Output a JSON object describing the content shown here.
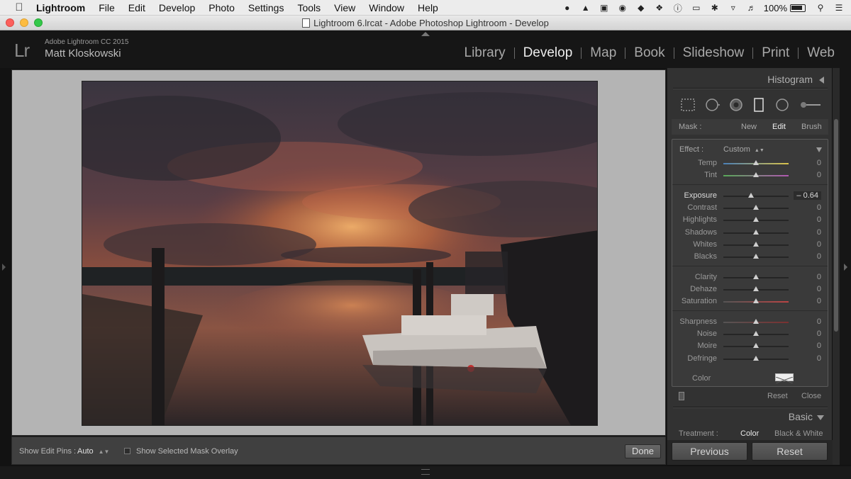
{
  "menubar": {
    "app": "Lightroom",
    "items": [
      "File",
      "Edit",
      "Develop",
      "Photo",
      "Settings",
      "Tools",
      "View",
      "Window",
      "Help"
    ],
    "battery": "100%"
  },
  "window": {
    "title": "Lightroom 6.lrcat - Adobe Photoshop Lightroom - Develop"
  },
  "identity": {
    "logo": "Lr",
    "brand": "Adobe Lightroom CC 2015",
    "user": "Matt Kloskowski"
  },
  "modules": [
    {
      "label": "Library",
      "active": false
    },
    {
      "label": "Develop",
      "active": true
    },
    {
      "label": "Map",
      "active": false
    },
    {
      "label": "Book",
      "active": false
    },
    {
      "label": "Slideshow",
      "active": false
    },
    {
      "label": "Print",
      "active": false
    },
    {
      "label": "Web",
      "active": false
    }
  ],
  "toolbar": {
    "edit_pins_label": "Show Edit Pins :",
    "edit_pins_value": "Auto",
    "overlay_label": "Show Selected Mask Overlay",
    "done_label": "Done"
  },
  "panel": {
    "histogram_title": "Histogram",
    "mask": {
      "label": "Mask :",
      "new": "New",
      "edit": "Edit",
      "brush": "Brush"
    },
    "effect": {
      "label": "Effect :",
      "value": "Custom"
    },
    "groups": [
      [
        {
          "name": "Temp",
          "value": "0",
          "position": 0.5
        },
        {
          "name": "Tint",
          "value": "0",
          "position": 0.5
        }
      ],
      [
        {
          "name": "Exposure",
          "value": "– 0.64",
          "position": 0.42
        },
        {
          "name": "Contrast",
          "value": "0",
          "position": 0.5
        },
        {
          "name": "Highlights",
          "value": "0",
          "position": 0.5
        },
        {
          "name": "Shadows",
          "value": "0",
          "position": 0.5
        },
        {
          "name": "Whites",
          "value": "0",
          "position": 0.5
        },
        {
          "name": "Blacks",
          "value": "0",
          "position": 0.5
        }
      ],
      [
        {
          "name": "Clarity",
          "value": "0",
          "position": 0.5
        },
        {
          "name": "Dehaze",
          "value": "0",
          "position": 0.5
        },
        {
          "name": "Saturation",
          "value": "0",
          "position": 0.5
        }
      ],
      [
        {
          "name": "Sharpness",
          "value": "0",
          "position": 0.5
        },
        {
          "name": "Noise",
          "value": "0",
          "position": 0.5
        },
        {
          "name": "Moire",
          "value": "0",
          "position": 0.5
        },
        {
          "name": "Defringe",
          "value": "0",
          "position": 0.5
        }
      ]
    ],
    "color_label": "Color",
    "reset_label": "Reset",
    "close_label": "Close",
    "basic_title": "Basic",
    "treatment": {
      "label": "Treatment :",
      "color": "Color",
      "bw": "Black & White"
    },
    "previous_button": "Previous",
    "reset_button": "Reset"
  },
  "colors": {
    "accent": "#ececec",
    "panel": "#323232",
    "canvas": "#b4b4b4"
  }
}
